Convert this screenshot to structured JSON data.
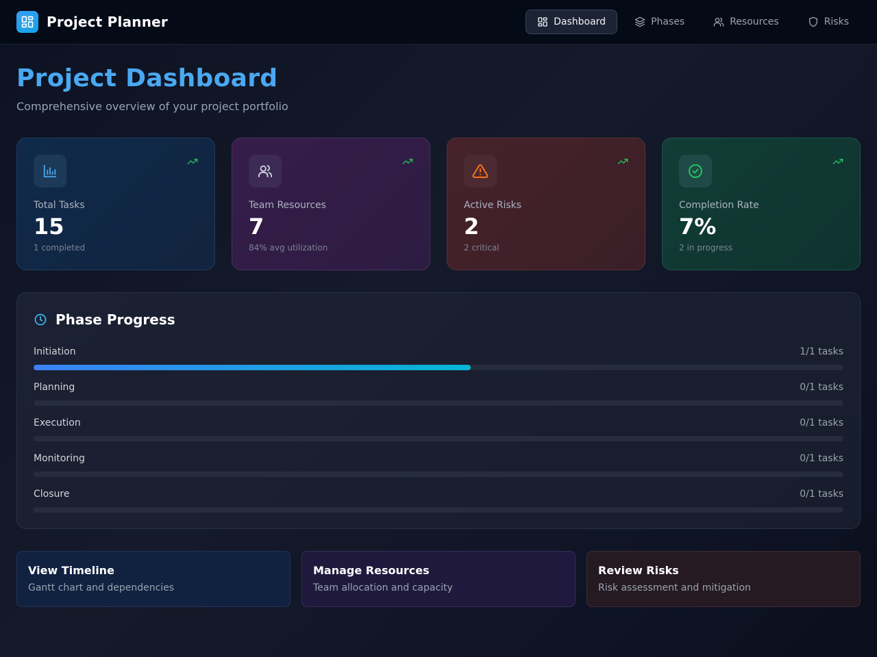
{
  "app": {
    "title": "Project Planner",
    "accent": "#3b9cf0"
  },
  "nav": {
    "items": [
      {
        "label": "Dashboard",
        "icon": "dashboard-icon",
        "active": true
      },
      {
        "label": "Phases",
        "icon": "layers-icon",
        "active": false
      },
      {
        "label": "Resources",
        "icon": "users-icon",
        "active": false
      },
      {
        "label": "Risks",
        "icon": "shield-icon",
        "active": false
      }
    ]
  },
  "page": {
    "title": "Project Dashboard",
    "subtitle": "Comprehensive overview of your project portfolio"
  },
  "stats": [
    {
      "label": "Total Tasks",
      "value": "15",
      "note": "1 completed",
      "icon": "bar-chart-icon",
      "color": "#4aa8f0"
    },
    {
      "label": "Team Resources",
      "value": "7",
      "note": "84% avg utilization",
      "icon": "users-icon",
      "color": "#cbd5e1"
    },
    {
      "label": "Active Risks",
      "value": "2",
      "note": "2 critical",
      "icon": "warning-icon",
      "color": "#f97316"
    },
    {
      "label": "Completion Rate",
      "value": "7%",
      "note": "2 in progress",
      "icon": "check-circle-icon",
      "color": "#22c55e"
    }
  ],
  "phase_progress": {
    "title": "Phase Progress",
    "icon": "clock-icon",
    "phases": [
      {
        "name": "Initiation",
        "count": "1/1 tasks",
        "progress": 0.54
      },
      {
        "name": "Planning",
        "count": "0/1 tasks",
        "progress": 0
      },
      {
        "name": "Execution",
        "count": "0/1 tasks",
        "progress": 0
      },
      {
        "name": "Monitoring",
        "count": "0/1 tasks",
        "progress": 0
      },
      {
        "name": "Closure",
        "count": "0/1 tasks",
        "progress": 0
      }
    ]
  },
  "actions": [
    {
      "title": "View Timeline",
      "description": "Gantt chart and dependencies"
    },
    {
      "title": "Manage Resources",
      "description": "Team allocation and capacity"
    },
    {
      "title": "Review Risks",
      "description": "Risk assessment and mitigation"
    }
  ]
}
